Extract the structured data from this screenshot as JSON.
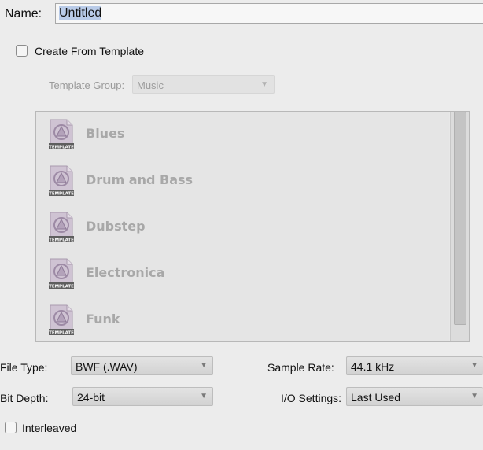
{
  "name": {
    "label": "Name:",
    "value": "Untitled"
  },
  "create_from_template": {
    "label": "Create From Template",
    "checked": false
  },
  "template_group": {
    "label": "Template Group:",
    "value": "Music"
  },
  "templates": [
    {
      "name": "Blues",
      "icon": "template-file-icon",
      "icon_caption": "TEMPLATE"
    },
    {
      "name": "Drum and Bass",
      "icon": "template-file-icon",
      "icon_caption": "TEMPLATE"
    },
    {
      "name": "Dubstep",
      "icon": "template-file-icon",
      "icon_caption": "TEMPLATE"
    },
    {
      "name": "Electronica",
      "icon": "template-file-icon",
      "icon_caption": "TEMPLATE"
    },
    {
      "name": "Funk",
      "icon": "template-file-icon",
      "icon_caption": "TEMPLATE"
    }
  ],
  "file_type": {
    "label": "File Type:",
    "value": "BWF (.WAV)"
  },
  "sample_rate": {
    "label": "Sample Rate:",
    "value": "44.1 kHz"
  },
  "bit_depth": {
    "label": "Bit Depth:",
    "value": "24-bit"
  },
  "io_settings": {
    "label": "I/O Settings:",
    "value": "Last Used"
  },
  "interleaved": {
    "label": "Interleaved",
    "checked": false
  },
  "colors": {
    "background": "#ececec",
    "selection": "#b9cbe8",
    "disabled_text": "#a8a8a8"
  }
}
